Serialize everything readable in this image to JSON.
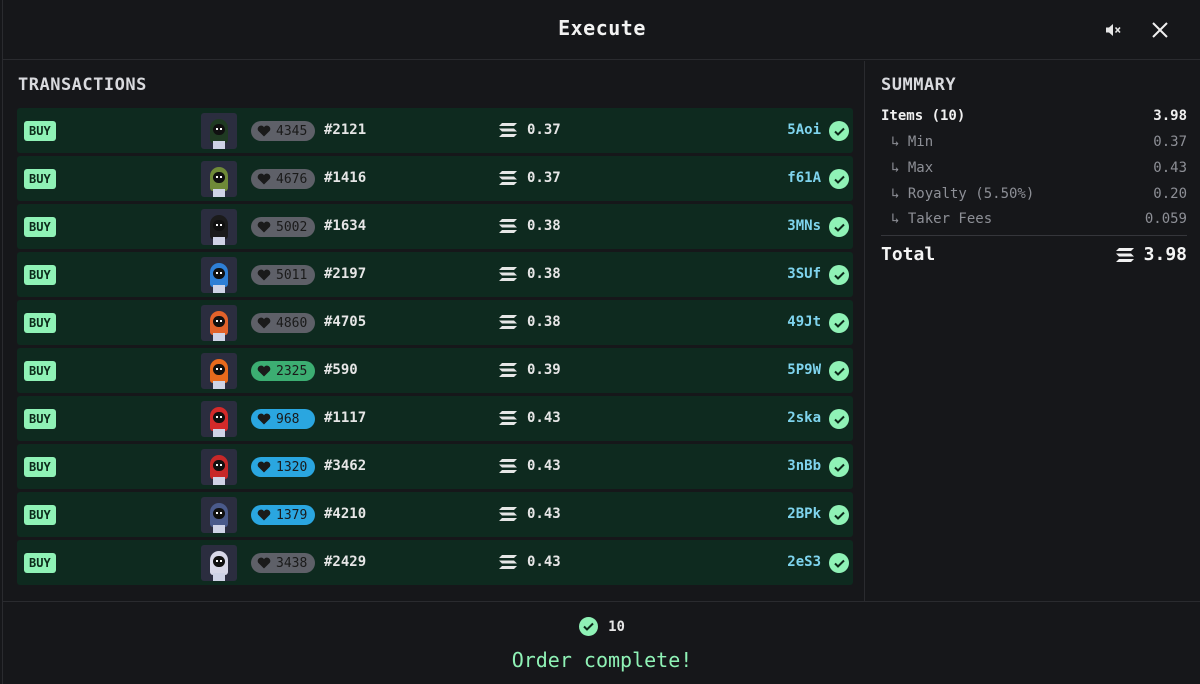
{
  "header": {
    "title": "Execute",
    "mute_icon": "speaker-muted-icon",
    "close_icon": "close-icon"
  },
  "transactions": {
    "title": "TRANSACTIONS",
    "rows": [
      {
        "action": "BUY",
        "rank": "4345",
        "rank_color": "gray",
        "token": "#2121",
        "price": "0.37",
        "sig": "5Aoi",
        "hood_color": "#1f3a22"
      },
      {
        "action": "BUY",
        "rank": "4676",
        "rank_color": "gray",
        "token": "#1416",
        "price": "0.37",
        "sig": "f61A",
        "hood_color": "#6f8a38"
      },
      {
        "action": "BUY",
        "rank": "5002",
        "rank_color": "gray",
        "token": "#1634",
        "price": "0.38",
        "sig": "3MNs",
        "hood_color": "#1b1b1b"
      },
      {
        "action": "BUY",
        "rank": "5011",
        "rank_color": "gray",
        "token": "#2197",
        "price": "0.38",
        "sig": "3SUf",
        "hood_color": "#2e7fd6"
      },
      {
        "action": "BUY",
        "rank": "4860",
        "rank_color": "gray",
        "token": "#4705",
        "price": "0.38",
        "sig": "49Jt",
        "hood_color": "#e2622a"
      },
      {
        "action": "BUY",
        "rank": "2325",
        "rank_color": "green",
        "token": "#590",
        "price": "0.39",
        "sig": "5P9W",
        "hood_color": "#e86a1c"
      },
      {
        "action": "BUY",
        "rank": "968",
        "rank_color": "blue",
        "token": "#1117",
        "price": "0.43",
        "sig": "2ska",
        "hood_color": "#d42a2a"
      },
      {
        "action": "BUY",
        "rank": "1320",
        "rank_color": "blue",
        "token": "#3462",
        "price": "0.43",
        "sig": "3nBb",
        "hood_color": "#c82828"
      },
      {
        "action": "BUY",
        "rank": "1379",
        "rank_color": "blue",
        "token": "#4210",
        "price": "0.43",
        "sig": "2BPk",
        "hood_color": "#4a5a8a"
      },
      {
        "action": "BUY",
        "rank": "3438",
        "rank_color": "gray",
        "token": "#2429",
        "price": "0.43",
        "sig": "2eS3",
        "hood_color": "#d8d8e8"
      }
    ]
  },
  "summary": {
    "title": "SUMMARY",
    "items_label": "Items (10)",
    "items_value": "3.98",
    "min_label": "↳ Min",
    "min_value": "0.37",
    "max_label": "↳ Max",
    "max_value": "0.43",
    "royalty_label": "↳ Royalty (5.50%)",
    "royalty_value": "0.20",
    "fees_label": "↳ Taker Fees",
    "fees_value": "0.059",
    "total_label": "Total",
    "total_value": "3.98"
  },
  "footer": {
    "count": "10",
    "status": "Order complete!"
  },
  "colors": {
    "row_bg": "#0e2a1f",
    "accent": "#8ff2b6",
    "sig": "#7fd4ee"
  }
}
